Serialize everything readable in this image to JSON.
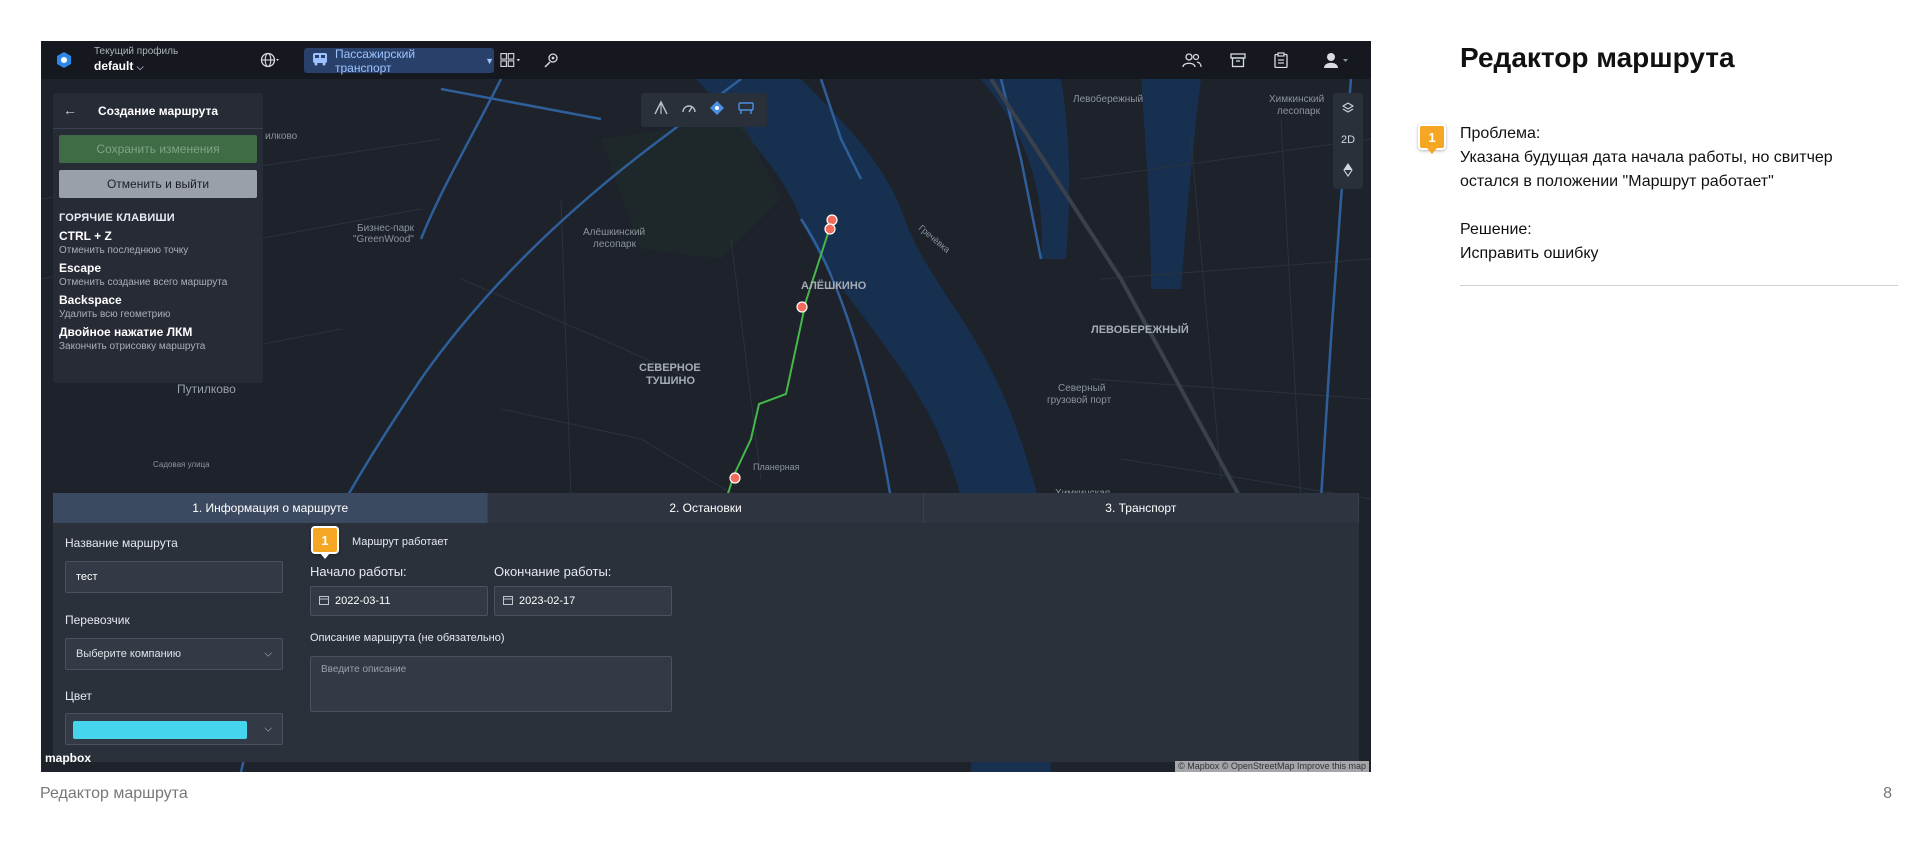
{
  "screenshot": {
    "topbar": {
      "profile_caption": "Текущий профиль",
      "profile_value": "default",
      "transport_label": "Пассажирский транспорт"
    },
    "hotkeys_panel": {
      "title": "Создание маршрута",
      "save_label": "Сохранить изменения",
      "cancel_label": "Отменить и выйти",
      "section_title": "ГОРЯЧИЕ КЛАВИШИ",
      "items": [
        {
          "key": "CTRL + Z",
          "desc": "Отменить последнюю точку"
        },
        {
          "key": "Escape",
          "desc": "Отменить создание всего маршрута"
        },
        {
          "key": "Backspace",
          "desc": "Удалить всю геометрию"
        },
        {
          "key": "Двойное нажатие ЛКМ",
          "desc": "Закончить отрисовку маршрута"
        }
      ]
    },
    "map": {
      "view_mode": "2D",
      "labels": [
        "Левобережный",
        "Химкинский лесопарк",
        "Бизнес-парк \"GreenWood\"",
        "Алёшкинский лесопарк",
        "АЛЁШКИНО",
        "ЛЕВОБЕРЕЖНЫЙ",
        "СЕВЕРНОЕ ТУШИНО",
        "Путилково",
        "Северный грузовой порт",
        "Химкинская",
        "Планерная",
        "Садовая улица",
        "Гречёвка",
        "илково"
      ],
      "attribution": "© Mapbox © OpenStreetMap  Improve this map",
      "logo_text": "mapbox"
    },
    "form": {
      "tabs": [
        "1. Информация о маршруте",
        "2. Остановки",
        "3. Транспорт"
      ],
      "active_tab": 0,
      "name_label": "Название маршрута",
      "name_value": "тест",
      "carrier_label": "Перевозчик",
      "carrier_value": "Выберите компанию",
      "color_label": "Цвет",
      "color_value": "#45d6ee",
      "status_label": "Маршрут работает",
      "start_label": "Начало работы:",
      "start_value": "2022-03-11",
      "end_label": "Окончание работы:",
      "end_value": "2023-02-17",
      "desc_label": "Описание маршрута (не обязательно)",
      "desc_placeholder": "Введите описание"
    },
    "marker_number": "1"
  },
  "slide": {
    "title": "Редактор маршрута",
    "marker_number": "1",
    "problem_label": "Проблема:",
    "problem_text": "Указана будущая дата начала работы, но свитчер остался в положении \"Маршрут работает\"",
    "solution_label": "Решение:",
    "solution_text": "Исправить ошибку",
    "footer_title": "Редактор маршрута",
    "page_number": "8",
    "accent_color": "#f5a623"
  }
}
